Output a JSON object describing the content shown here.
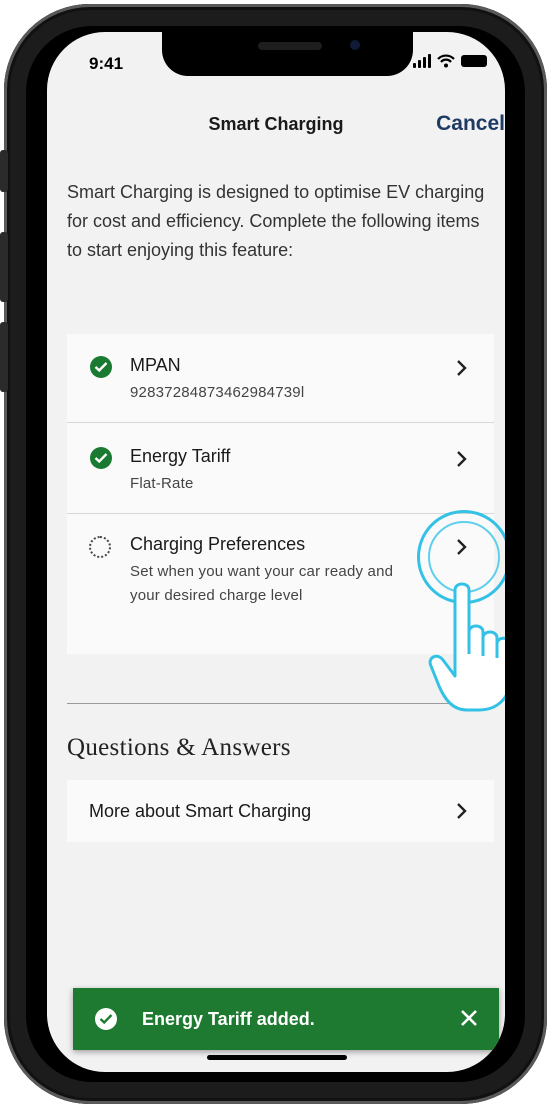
{
  "status_bar": {
    "time": "9:41"
  },
  "nav": {
    "title": "Smart Charging",
    "cancel_label": "Cancel"
  },
  "intro": {
    "text": "Smart Charging is designed to optimise EV charging for cost and efficiency. Complete the following items to start enjoying this feature:"
  },
  "setup_items": [
    {
      "title": "MPAN",
      "subtitle": "92837284873462984739l",
      "status": "complete"
    },
    {
      "title": "Energy Tariff",
      "subtitle": "Flat-Rate",
      "status": "complete"
    },
    {
      "title": "Charging Preferences",
      "subtitle": "Set when you want your car ready and your desired charge level",
      "status": "incomplete"
    }
  ],
  "qa": {
    "heading": "Questions & Answers",
    "item_label": "More about Smart Charging"
  },
  "toast": {
    "message": "Energy Tariff added."
  },
  "colors": {
    "accent_green": "#1f7a31",
    "cancel_blue": "#1f3b63",
    "tap_highlight": "#33c1e6"
  },
  "icons": [
    "check-circle-icon",
    "dotted-circle-icon",
    "chevron-right-icon",
    "close-icon",
    "tap-hand-icon",
    "signal-icon",
    "wifi-icon",
    "battery-icon"
  ]
}
